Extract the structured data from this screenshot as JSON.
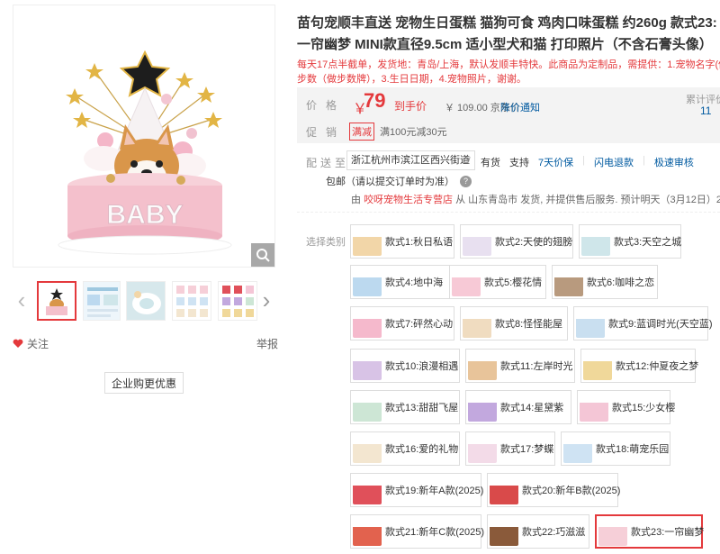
{
  "product": {
    "title": "苗句宠顺丰直送 宠物生日蛋糕 猫狗可食 鸡肉口味蛋糕 约260g 款式23:一帘幽梦 MINI款直径9.5cm 适小型犬和猫 打印照片（不含石膏头像）",
    "cake_text": "BABY",
    "promo_line1": "每天17点半截单，发货地：青岛/上海，默认发顺丰特快。此商品为定制品，需提供：1.宠物名字(做名字牌)",
    "promo_line2": "步数（做步数牌），3.生日日期，4.宠物照片，谢谢。"
  },
  "gallery": {
    "follow_label": "关注",
    "report_label": "举报",
    "business_button": "企业购更优惠",
    "thumb_count": 5,
    "active_thumb": 0
  },
  "price": {
    "label": "价格",
    "symbol": "￥",
    "value": "79",
    "tag": "到手价",
    "jd_price": "￥ 109.00 京东价",
    "notify": "降价通知",
    "review_label": "累计评价",
    "review_count": "11"
  },
  "promotion": {
    "label": "促销",
    "badge": "满减",
    "desc": "满100元减30元"
  },
  "delivery": {
    "label": "配送至",
    "address": "浙江杭州市滨江区西兴街道",
    "stock": "有货",
    "support": "支持",
    "service1": "7天价保",
    "service2": "闪电退款",
    "service3": "极速审核",
    "package": "包邮（请以提交订单时为准）",
    "ship_prefix": "由",
    "shop": "咬呀宠物生活专营店",
    "ship_text": "从 山东青岛市 发货, 并提供售后服务. 预计明天（3月12日）24:00前发货"
  },
  "selection": {
    "label": "选择类别",
    "options": [
      {
        "label": "款式1:秋日私语",
        "color": "#f2d6a8"
      },
      {
        "label": "款式2:天使的翅膀",
        "color": "#e8e0f0"
      },
      {
        "label": "款式3:天空之城",
        "color": "#cfe6ea"
      },
      {
        "label": "款式4:地中海",
        "color": "#bcd9ef"
      },
      {
        "label": "款式5:樱花情",
        "color": "#f7c9d6"
      },
      {
        "label": "款式6:咖啡之恋",
        "color": "#b89a7e"
      },
      {
        "label": "款式7:砰然心动",
        "color": "#f5b9cc"
      },
      {
        "label": "款式8:怪怪能屋",
        "color": "#f0dcc0"
      },
      {
        "label": "款式9:蓝调时光(天空蓝)",
        "color": "#c9dff0"
      },
      {
        "label": "款式10:浪漫相遇",
        "color": "#d8c3e6"
      },
      {
        "label": "款式11:左岸时光",
        "color": "#e8c49a"
      },
      {
        "label": "款式12:仲夏夜之梦",
        "color": "#f0d89a"
      },
      {
        "label": "款式13:甜甜飞屋",
        "color": "#cde6d5"
      },
      {
        "label": "款式14:星黛紫",
        "color": "#c2a8de"
      },
      {
        "label": "款式15:少女樱",
        "color": "#f4c6d6"
      },
      {
        "label": "款式16:爱的礼物",
        "color": "#f3e6d0"
      },
      {
        "label": "款式17:梦蝶",
        "color": "#f3dbe8"
      },
      {
        "label": "款式18:萌宠乐园",
        "color": "#cfe3f3"
      },
      {
        "label": "款式19:新年A款(2025)",
        "color": "#e0505a"
      },
      {
        "label": "款式20:新年B款(2025)",
        "color": "#d94a4a"
      },
      {
        "label": "款式21:新年C款(2025)",
        "color": "#e2624e"
      },
      {
        "label": "款式22:巧滋滋",
        "color": "#8a5a3a"
      },
      {
        "label": "款式23:一帘幽梦",
        "color": "#f6cfd8"
      }
    ],
    "selected_index": 22
  }
}
